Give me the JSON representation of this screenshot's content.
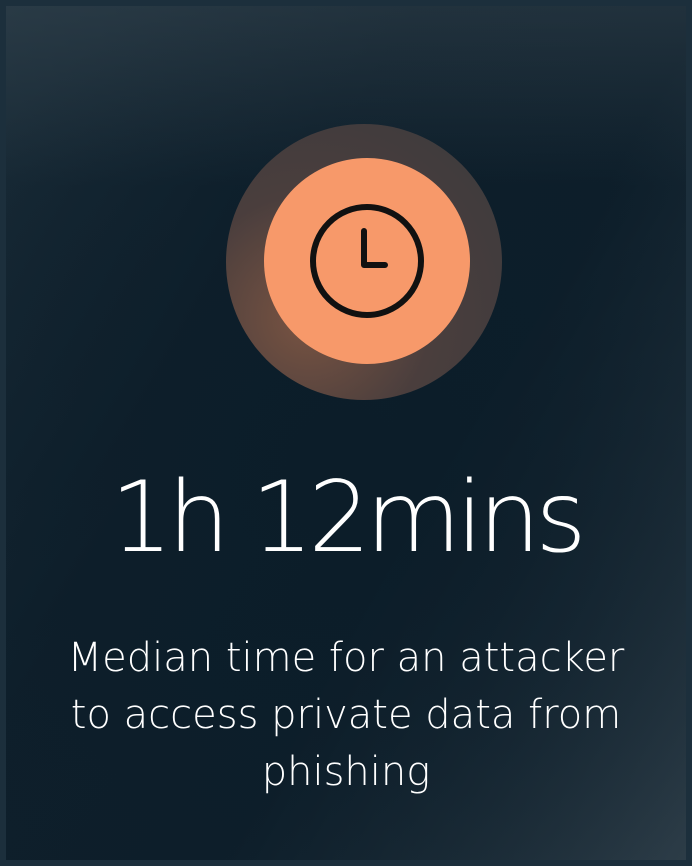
{
  "card": {
    "icon": "clock-icon",
    "stat": "1h 12mins",
    "caption": "Median time for an attacker to access private data from phishing",
    "accent_color": "#f7996a"
  }
}
